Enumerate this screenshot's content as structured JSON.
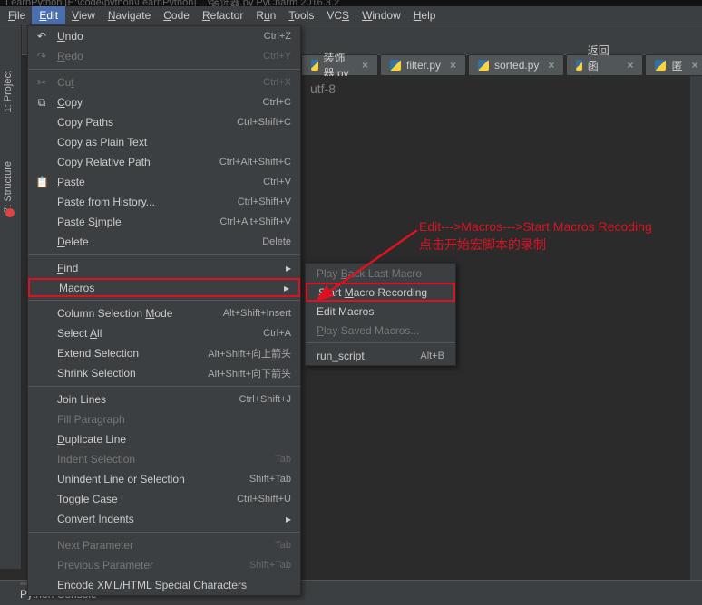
{
  "title_bar": "LearnPython  [E:\\code\\python\\LearnPython]  ...\\装饰器.py  PyCharm 2016.3.2",
  "menu_bar": {
    "items": [
      {
        "pre": "",
        "ul": "F",
        "post": "ile"
      },
      {
        "pre": "",
        "ul": "E",
        "post": "dit"
      },
      {
        "pre": "",
        "ul": "V",
        "post": "iew"
      },
      {
        "pre": "",
        "ul": "N",
        "post": "avigate"
      },
      {
        "pre": "",
        "ul": "C",
        "post": "ode"
      },
      {
        "pre": "",
        "ul": "R",
        "post": "efactor"
      },
      {
        "pre": "R",
        "ul": "u",
        "post": "n"
      },
      {
        "pre": "",
        "ul": "T",
        "post": "ools"
      },
      {
        "pre": "VC",
        "ul": "S",
        "post": ""
      },
      {
        "pre": "",
        "ul": "W",
        "post": "indow"
      },
      {
        "pre": "",
        "ul": "H",
        "post": "elp"
      }
    ],
    "selected_index": 1
  },
  "tabs": [
    {
      "label": "装饰器.py"
    },
    {
      "label": "filter.py"
    },
    {
      "label": "sorted.py"
    },
    {
      "label": "返回函数.py"
    },
    {
      "label": "匿"
    }
  ],
  "editor": {
    "visible_text": "utf-8"
  },
  "side_label_proj": "1: Project",
  "side_label_struct": "7: Structure",
  "edit_menu": {
    "sections": [
      [
        {
          "icon": "↶",
          "label": "Undo",
          "shortcut": "Ctrl+Z",
          "ul": 0
        },
        {
          "icon": "↷",
          "disabled": true,
          "label": "Redo",
          "shortcut": "Ctrl+Y",
          "ul": 0
        }
      ],
      [
        {
          "icon": "✂",
          "disabled": true,
          "label": "Cut",
          "shortcut": "Ctrl+X",
          "ul": 2
        },
        {
          "icon": "⧉",
          "label": "Copy",
          "shortcut": "Ctrl+C",
          "ul": 0
        },
        {
          "label": "Copy Paths",
          "shortcut": "Ctrl+Shift+C"
        },
        {
          "label": "Copy as Plain Text"
        },
        {
          "label": "Copy Relative Path",
          "shortcut": "Ctrl+Alt+Shift+C"
        },
        {
          "icon": "📋",
          "label": "Paste",
          "shortcut": "Ctrl+V",
          "ul": 0
        },
        {
          "label": "Paste from History...",
          "shortcut": "Ctrl+Shift+V"
        },
        {
          "label": "Paste Simple",
          "shortcut": "Ctrl+Alt+Shift+V",
          "ul": 7
        },
        {
          "label": "Delete",
          "shortcut": "Delete",
          "ul": 0
        }
      ],
      [
        {
          "label": "Find",
          "arrow": true,
          "ul": 0
        },
        {
          "label": "Macros",
          "arrow": true,
          "ul": 0,
          "redbox": true
        }
      ],
      [
        {
          "label": "Column Selection Mode",
          "shortcut": "Alt+Shift+Insert",
          "ul": 17
        },
        {
          "label": "Select All",
          "shortcut": "Ctrl+A",
          "ul": 7
        },
        {
          "label": "Extend Selection",
          "shortcut": "Alt+Shift+向上箭头"
        },
        {
          "label": "Shrink Selection",
          "shortcut": "Alt+Shift+向下箭头"
        }
      ],
      [
        {
          "label": "Join Lines",
          "shortcut": "Ctrl+Shift+J"
        },
        {
          "disabled": true,
          "label": "Fill Paragraph"
        },
        {
          "label": "Duplicate Line",
          "ul": 0
        },
        {
          "disabled": true,
          "label": "Indent Selection",
          "shortcut": "Tab"
        },
        {
          "label": "Unindent Line or Selection",
          "shortcut": "Shift+Tab"
        },
        {
          "label": "Toggle Case",
          "shortcut": "Ctrl+Shift+U"
        },
        {
          "label": "Convert Indents",
          "arrow": true
        }
      ],
      [
        {
          "disabled": true,
          "label": "Next Parameter",
          "shortcut": "Tab"
        },
        {
          "disabled": true,
          "label": "Previous Parameter",
          "shortcut": "Shift+Tab"
        },
        {
          "label": "Encode XML/HTML Special Characters"
        }
      ]
    ]
  },
  "macros_submenu": [
    {
      "disabled": true,
      "label": "Play Back Last Macro",
      "ul": 5
    },
    {
      "label": "Start Macro Recording",
      "redbox": true,
      "ul": 6
    },
    {
      "label": "Edit Macros"
    },
    {
      "disabled": true,
      "label": "Play Saved Macros...",
      "ul": 0
    },
    {
      "sep": true
    },
    {
      "label": "run_script",
      "shortcut": "Alt+B"
    }
  ],
  "annotation": {
    "line1": "Edit--->Macros--->Start Macros Recoding",
    "line2": "点击开始宏脚本的录制"
  },
  "footer": {
    "python_console": "Python Console"
  }
}
